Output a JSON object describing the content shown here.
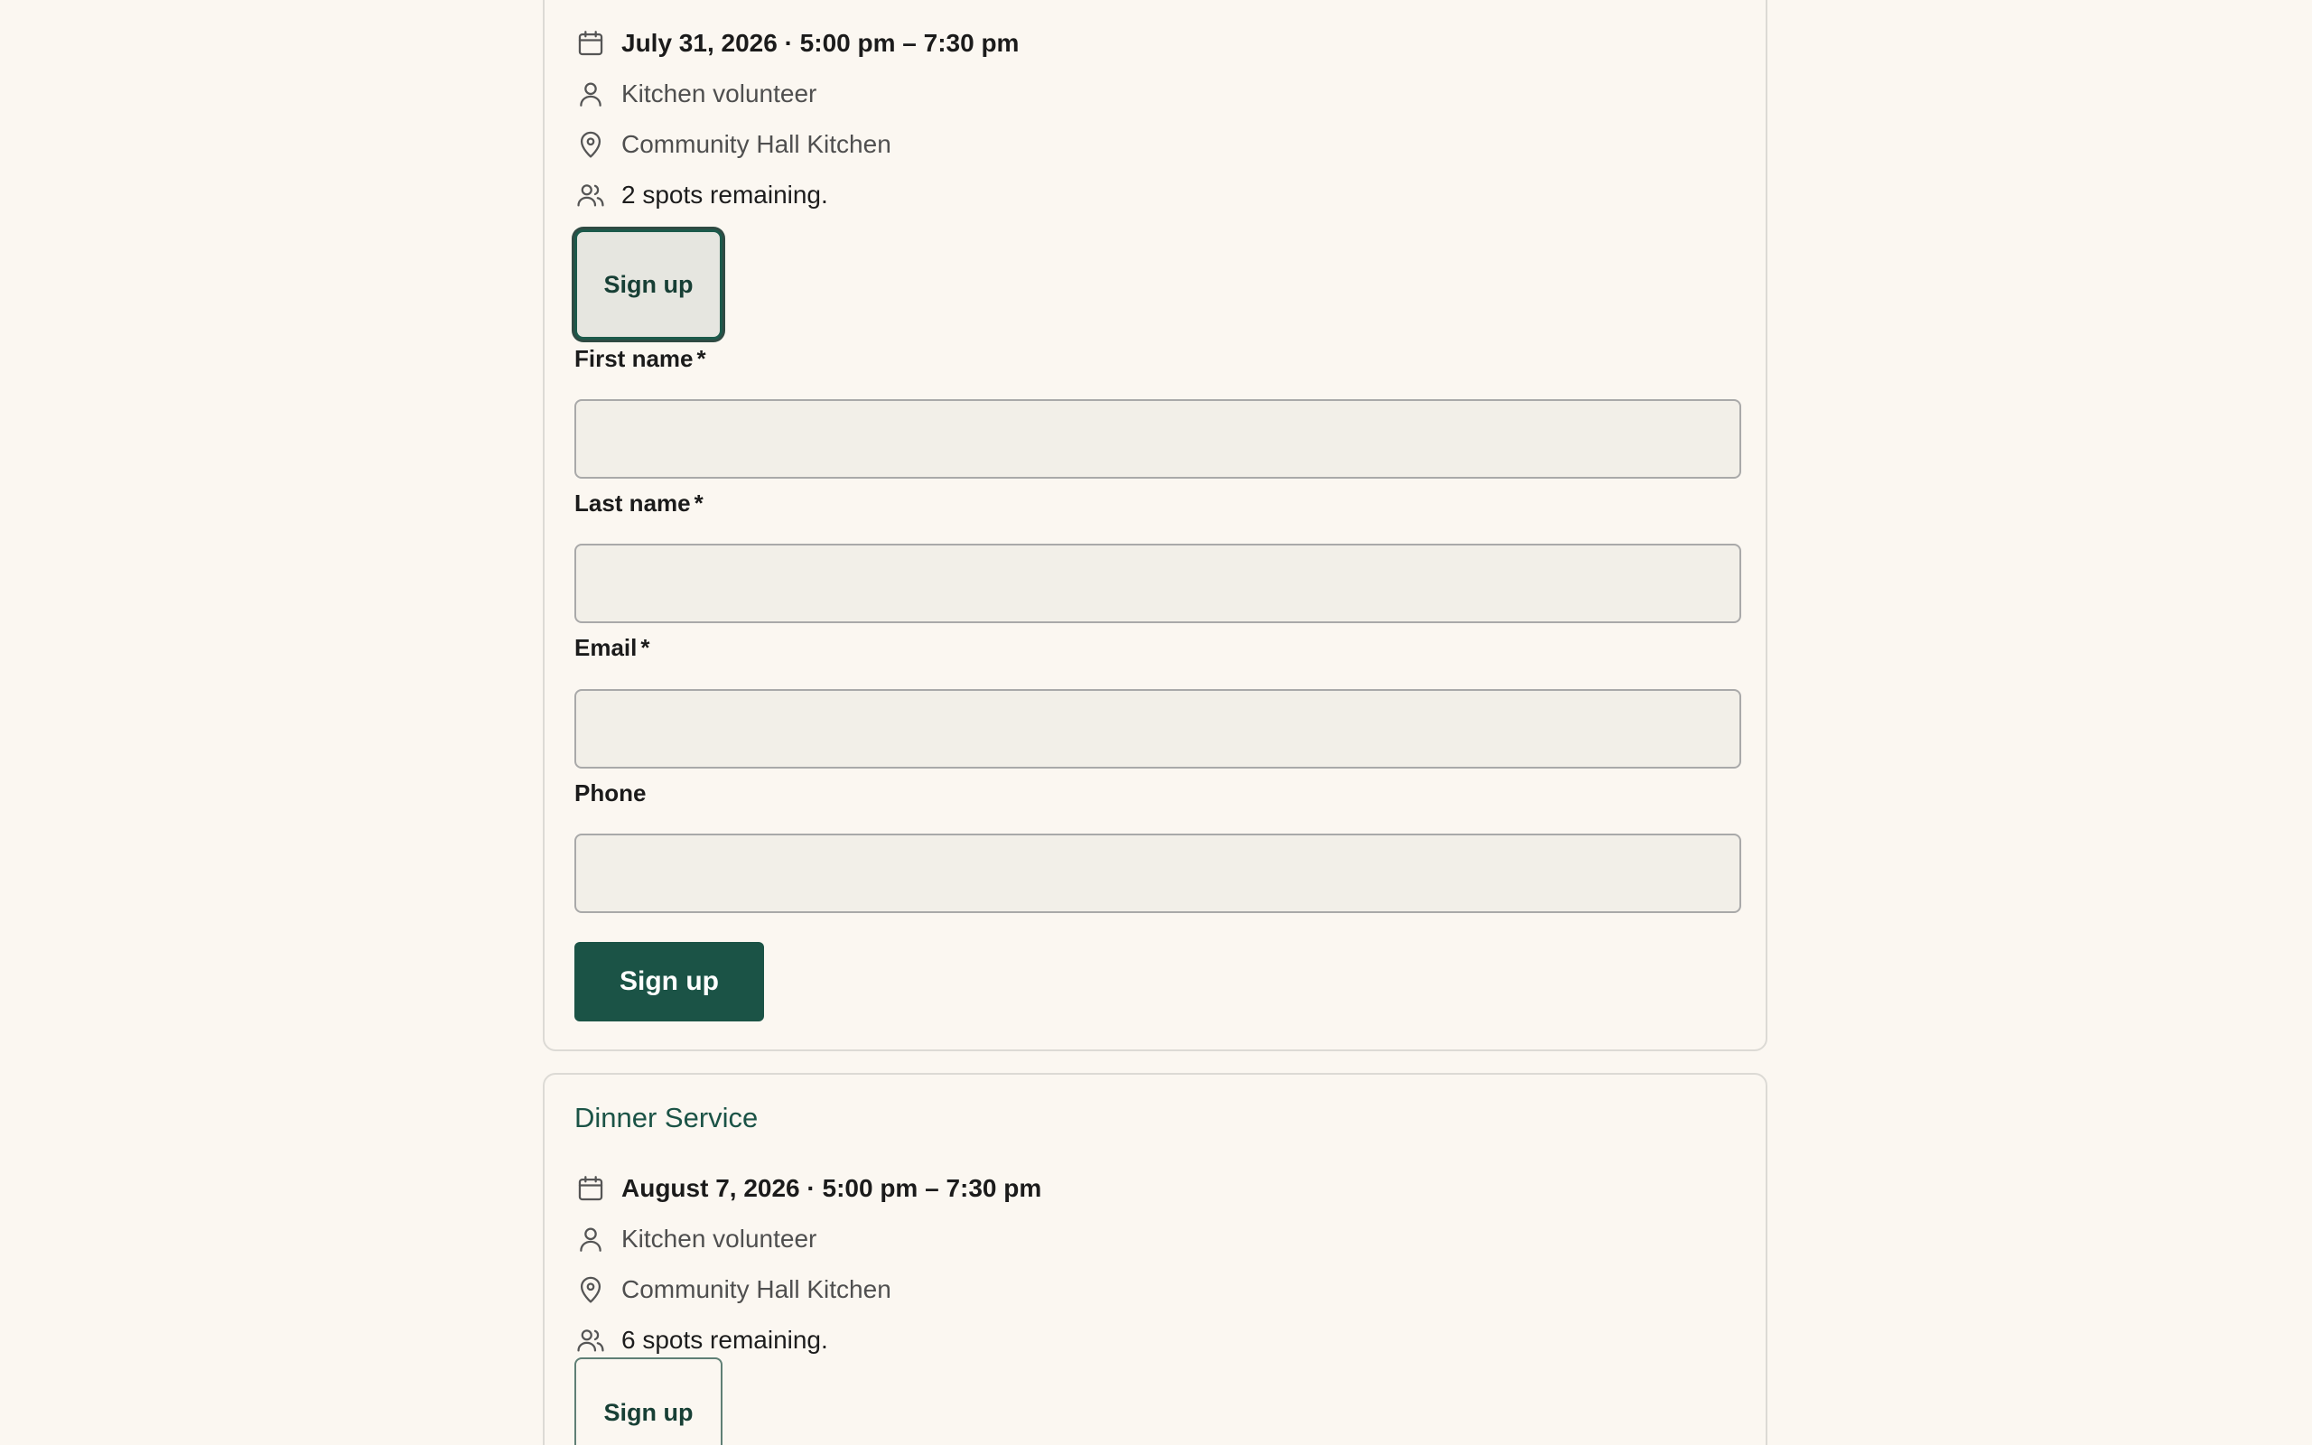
{
  "shifts": [
    {
      "date": "July 31, 2026 · 5:00 pm – 7:30 pm",
      "role": "Kitchen volunteer",
      "location": "Community Hall Kitchen",
      "spots": "2 spots remaining.",
      "toggle_label": "Sign up"
    },
    {
      "title": "Dinner Service",
      "date": "August 7, 2026 · 5:00 pm – 7:30 pm",
      "role": "Kitchen volunteer",
      "location": "Community Hall Kitchen",
      "spots": "6 spots remaining.",
      "toggle_label": "Sign up"
    }
  ],
  "form": {
    "first_name_label": "First name",
    "last_name_label": "Last name",
    "email_label": "Email",
    "phone_label": "Phone",
    "required_mark": "*",
    "first_name_value": "",
    "last_name_value": "",
    "email_value": "",
    "phone_value": "",
    "submit_label": "Sign up"
  },
  "colors": {
    "accent": "#1b5346",
    "background": "#fbf7f1",
    "input_background": "#f2efe8"
  },
  "icons": [
    "calendar-icon",
    "person-icon",
    "location-pin-icon",
    "people-icon"
  ]
}
